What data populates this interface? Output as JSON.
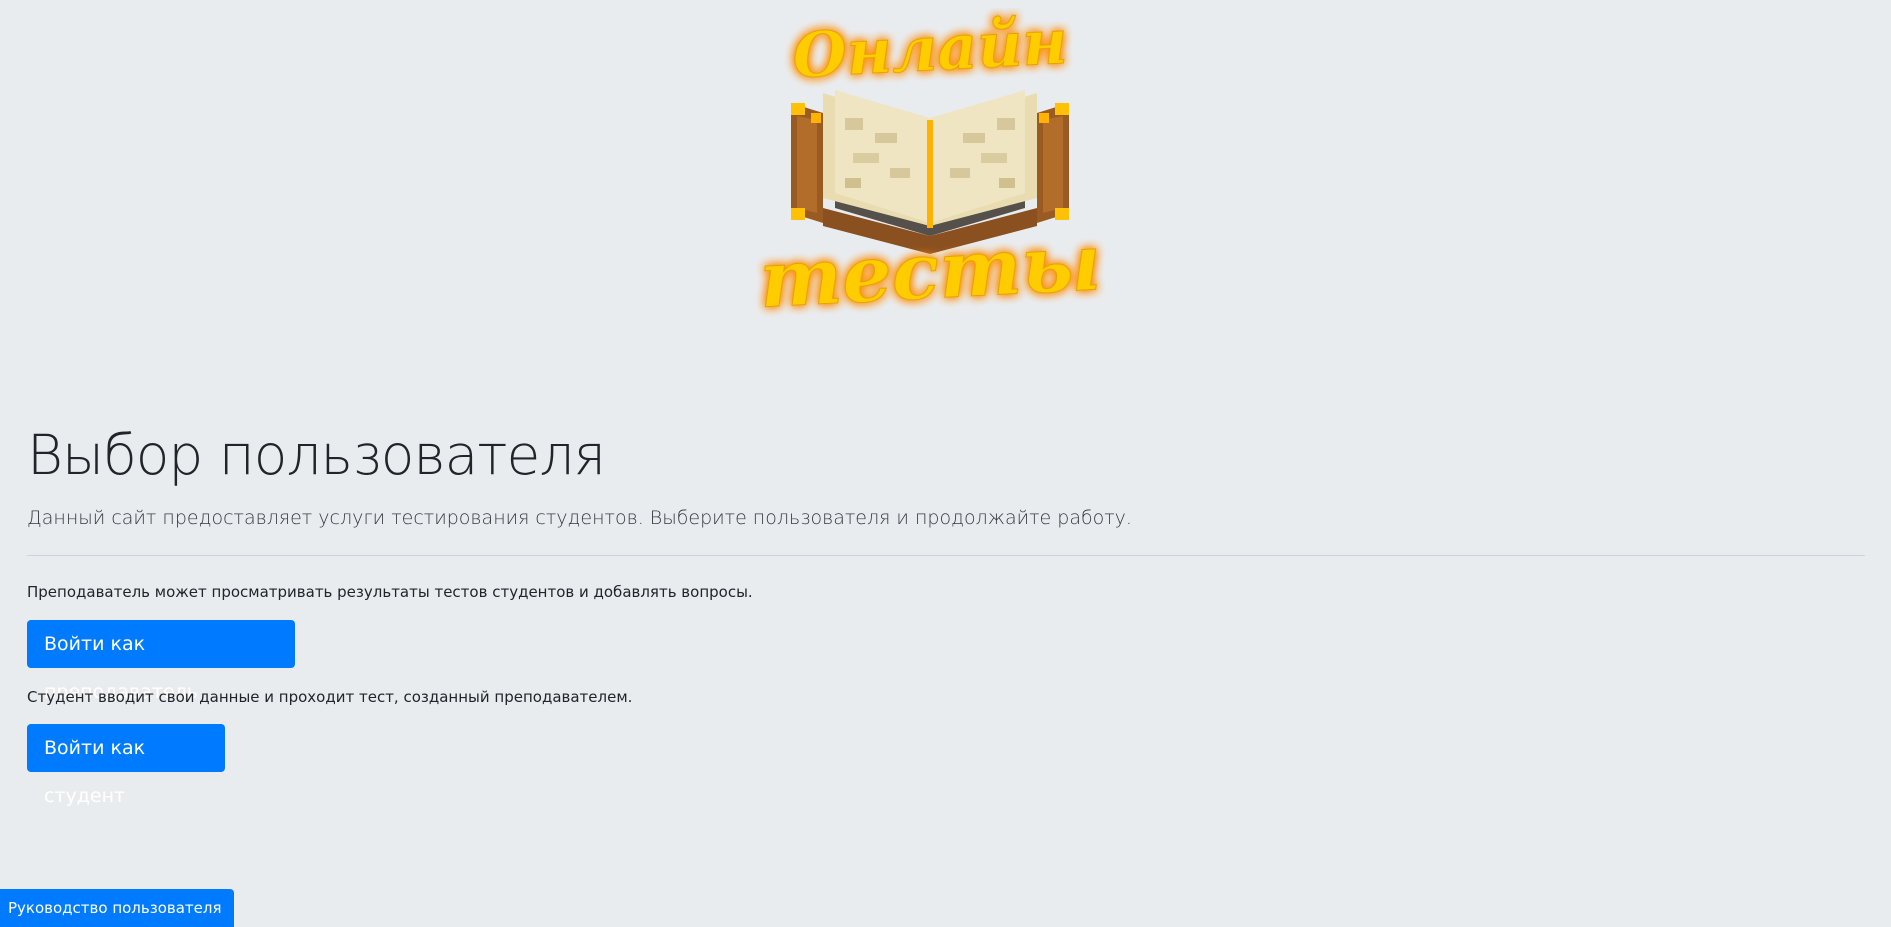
{
  "logo": {
    "text_top": "Онлайн",
    "text_bottom": "тесты",
    "icon": "open-book-icon"
  },
  "main": {
    "title": "Выбор пользователя",
    "lead": "Данный сайт предоставляет услуги тестирования студентов. Выберите пользователя и продолжайте работу.",
    "teacher_desc": "Преподаватель может просматривать результаты тестов студентов и добавлять вопросы.",
    "teacher_button": "Войти как преподаватель",
    "student_desc": "Студент вводит свои данные и проходит тест, созданный преподавателем.",
    "student_button": "Войти как студент"
  },
  "footer": {
    "guide_button": "Руководство пользователя"
  },
  "colors": {
    "background": "#e9ecef",
    "primary": "#007bff",
    "logo_text": "#ffcc00",
    "logo_glow": "#ff8c00"
  }
}
